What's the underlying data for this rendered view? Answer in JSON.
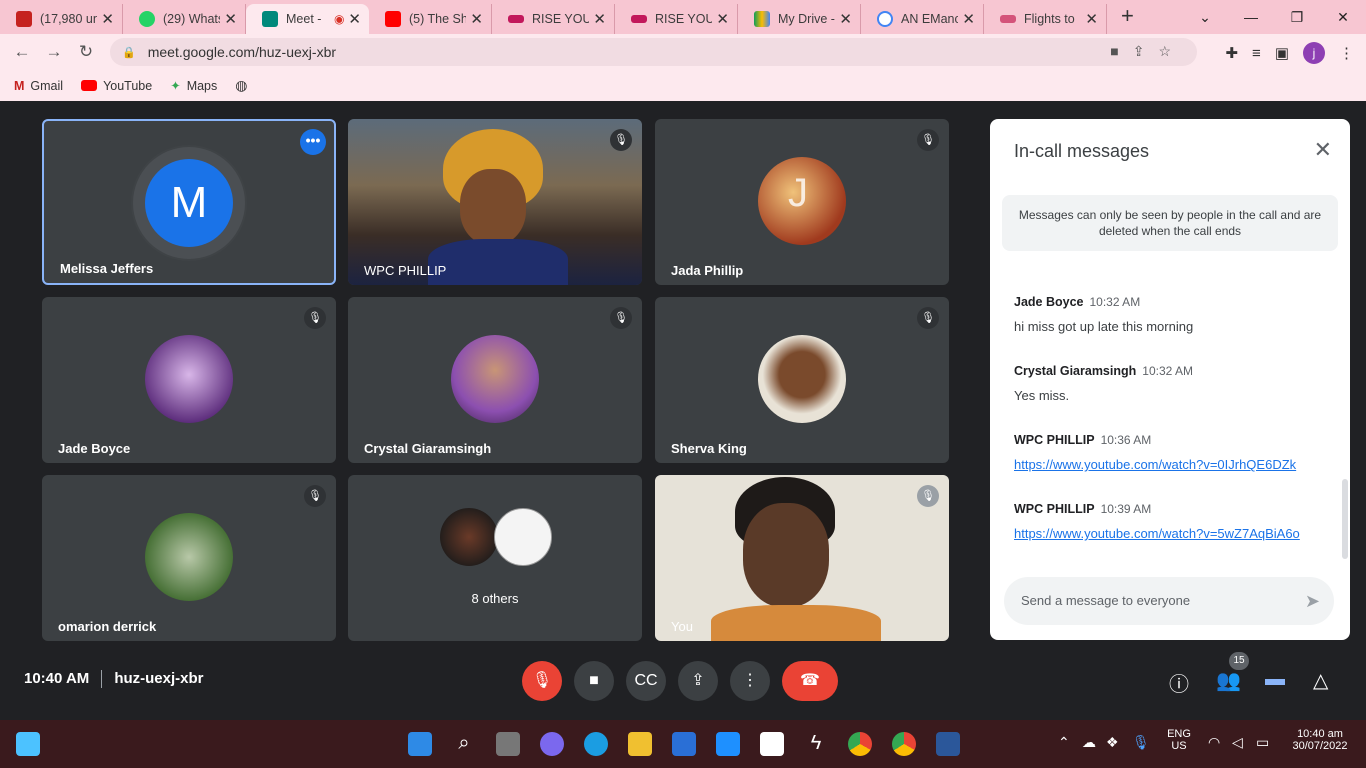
{
  "tabs": [
    {
      "title": "(17,980 un",
      "color": "#c5221f"
    },
    {
      "title": "(29) Whats",
      "color": "#25d366"
    },
    {
      "title": "Meet -",
      "color": "#00897b"
    },
    {
      "title": "(5) The Sh",
      "color": "#ff0000"
    },
    {
      "title": "RISE YOUT",
      "color": "#c2185b"
    },
    {
      "title": "RISE YOUT",
      "color": "#c2185b"
    },
    {
      "title": "My Drive -",
      "color": "#fbbc04"
    },
    {
      "title": "AN EManc",
      "color": "#4285f4"
    },
    {
      "title": "Flights to",
      "color": "#d4537a"
    }
  ],
  "browser": {
    "url": "meet.google.com/huz-uexj-xbr",
    "avatar_letter": "j"
  },
  "bookmarks": [
    "Gmail",
    "YouTube",
    "Maps"
  ],
  "meet": {
    "participants": [
      {
        "name": "Melissa Jeffers",
        "initial": "M"
      },
      {
        "name": "WPC PHILLIP"
      },
      {
        "name": "Jada Phillip"
      },
      {
        "name": "Jade Boyce"
      },
      {
        "name": "Crystal Giaramsingh"
      },
      {
        "name": "Sherva King"
      },
      {
        "name": "omarion derrick"
      },
      {
        "others": "8 others"
      },
      {
        "name": "You"
      }
    ],
    "time": "10:40 AM",
    "meeting_code": "huz-uexj-xbr",
    "people_count": "15"
  },
  "chat": {
    "title": "In-call messages",
    "notice": "Messages can only be seen by people in the call and are deleted when the call ends",
    "messages": [
      {
        "from": "Jade Boyce",
        "time": "10:32 AM",
        "text": "hi miss got up late this morning"
      },
      {
        "from": "Crystal Giaramsingh",
        "time": "10:32 AM",
        "text": "Yes miss."
      },
      {
        "from": "WPC PHILLIP",
        "time": "10:36 AM",
        "text": "https://www.youtube.com/watch?v=0IJrhQE6DZk"
      },
      {
        "from": "WPC PHILLIP",
        "time": "10:39 AM",
        "text": "https://www.youtube.com/watch?v=5wZ7AqBiA6o"
      }
    ],
    "placeholder": "Send a message to everyone"
  },
  "taskbar": {
    "lang": "ENG",
    "region": "US",
    "time": "10:40 am",
    "date": "30/07/2022"
  }
}
